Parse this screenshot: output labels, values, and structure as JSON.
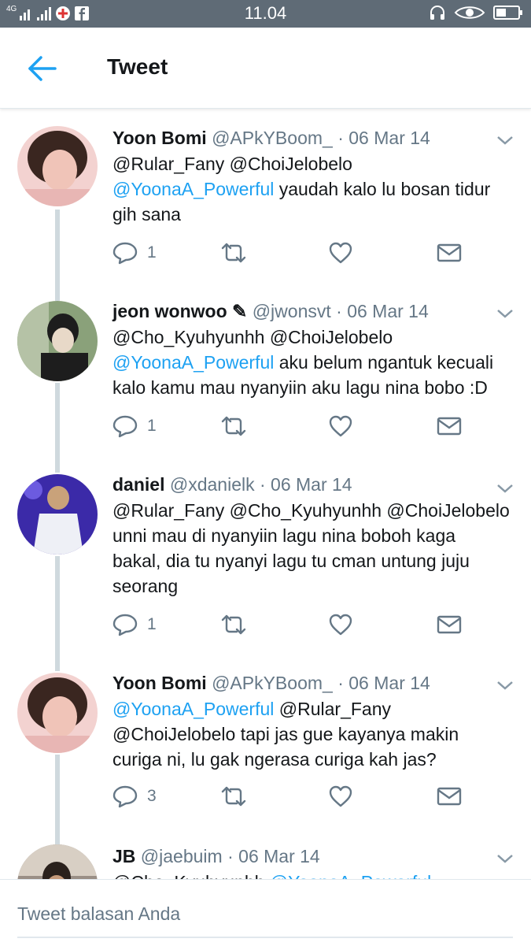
{
  "statusbar": {
    "network": "4G",
    "time": "11.04"
  },
  "header": {
    "title": "Tweet"
  },
  "tweets": [
    {
      "name": "Yoon Bomi",
      "handle": "@APkYBoom_",
      "date": "06 Mar 14",
      "line1": [
        {
          "t": "@Rular_Fany @ChoiJelobelo",
          "m": false
        }
      ],
      "line2": [
        {
          "t": "@YoonaA_Powerful",
          "m": true
        },
        {
          "t": " yaudah kalo lu bosan tidur",
          "m": false
        }
      ],
      "line3": [
        {
          "t": "gih sana",
          "m": false
        }
      ],
      "line4": [],
      "reply_count": "1",
      "avatar_colors": [
        "#f3d2d0",
        "#3a2620",
        "#f0c4b8"
      ]
    },
    {
      "name": "jeon wonwoo ✎",
      "handle": "@jwonsvt",
      "date": "06 Mar 14",
      "line1": [
        {
          "t": "@Cho_Kyuhyunhh @ChoiJelobelo",
          "m": false
        }
      ],
      "line2": [
        {
          "t": "@YoonaA_Powerful",
          "m": true
        },
        {
          "t": " aku belum ngantuk kecuali",
          "m": false
        }
      ],
      "line3": [
        {
          "t": "kalo kamu mau nyanyiin aku lagu nina bobo :D",
          "m": false
        }
      ],
      "line4": [],
      "reply_count": "1",
      "avatar_colors": [
        "#8aa17a",
        "#1d1d1d",
        "#e8d9c8"
      ]
    },
    {
      "name": "daniel",
      "handle": "@xdanielk",
      "date": "06 Mar 14",
      "line1": [
        {
          "t": "@Rular_Fany @Cho_Kyuhyunhh @ChoiJelobelo",
          "m": false
        }
      ],
      "line2": [
        {
          "t": "unni mau di nyanyiin lagu nina boboh kaga",
          "m": false
        }
      ],
      "line3": [
        {
          "t": "bakal, dia tu nyanyi lagu tu cman untung juju",
          "m": false
        }
      ],
      "line4": [
        {
          "t": "seorang",
          "m": false
        }
      ],
      "reply_count": "1",
      "avatar_colors": [
        "#3b2aa8",
        "#eef0f6",
        "#c9a27a"
      ]
    },
    {
      "name": "Yoon Bomi",
      "handle": "@APkYBoom_",
      "date": "06 Mar 14",
      "line1": [
        {
          "t": "@YoonaA_Powerful",
          "m": true
        },
        {
          "t": " @Rular_Fany",
          "m": false
        }
      ],
      "line2": [
        {
          "t": "@ChoiJelobelo tapi jas gue kayanya makin",
          "m": false
        }
      ],
      "line3": [
        {
          "t": "curiga ni, lu gak ngerasa curiga kah jas?",
          "m": false
        }
      ],
      "line4": [],
      "reply_count": "3",
      "avatar_colors": [
        "#f3d2d0",
        "#3a2620",
        "#f0c4b8"
      ]
    },
    {
      "name": "JB",
      "handle": "@jaebuim",
      "date": "06 Mar 14",
      "line1": [
        {
          "t": "@Cho_Kyuhyunhh ",
          "m": false
        },
        {
          "t": "@YoonaA_Powerful",
          "m": true
        }
      ],
      "line2": [],
      "line3": [],
      "line4": [],
      "reply_count": "",
      "avatar_colors": [
        "#9a8f86",
        "#2a211c",
        "#c59a7a"
      ]
    }
  ],
  "composer": {
    "placeholder": "Tweet balasan Anda"
  },
  "colors": {
    "accent": "#1da1f2",
    "muted": "#657786",
    "statusbar": "#5f6b76"
  }
}
